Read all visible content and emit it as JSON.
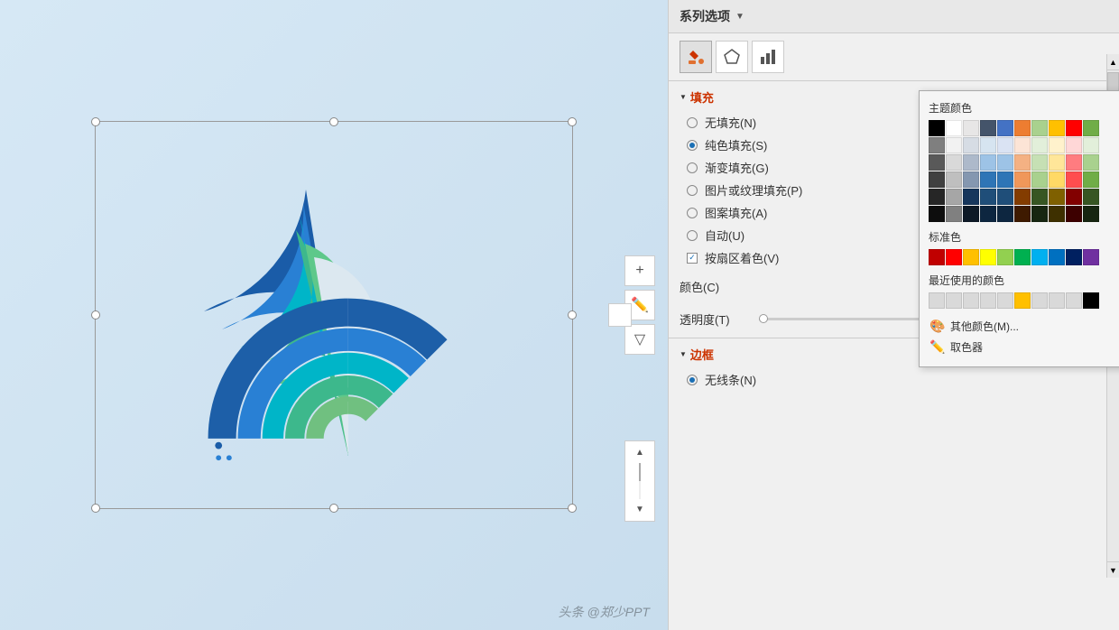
{
  "panel": {
    "title": "系列选项",
    "title_arrow": "▼",
    "tabs": [
      {
        "label": "🎨",
        "title": "fill-tab",
        "active": true
      },
      {
        "label": "⬠",
        "title": "shape-tab"
      },
      {
        "label": "📊",
        "title": "chart-tab"
      }
    ],
    "fill_section": {
      "header": "填充",
      "options": [
        {
          "label": "无填充(N)",
          "type": "radio",
          "selected": false
        },
        {
          "label": "纯色填充(S)",
          "type": "radio",
          "selected": true
        },
        {
          "label": "渐变填充(G)",
          "type": "radio",
          "selected": false
        },
        {
          "label": "图片或纹理填充(P)",
          "type": "radio",
          "selected": false
        },
        {
          "label": "图案填充(A)",
          "type": "radio",
          "selected": false
        },
        {
          "label": "自动(U)",
          "type": "radio",
          "selected": false
        },
        {
          "label": "按扇区着色(V)",
          "type": "checkbox",
          "checked": true
        }
      ]
    },
    "color_row": {
      "label": "颜色(C)",
      "swatch_color": "#e07030"
    },
    "transparency_row": {
      "label": "透明度(T)",
      "value": "0%",
      "slider_pos": 0
    },
    "border_section": {
      "header": "边框",
      "options": [
        {
          "label": "无线条(N)",
          "type": "radio",
          "selected": true
        }
      ]
    }
  },
  "color_popup": {
    "theme_title": "主题颜色",
    "theme_colors": [
      "#000000",
      "#ffffff",
      "#e7e6e6",
      "#44546a",
      "#4472c4",
      "#ed7d31",
      "#a9d18e",
      "#ffc000",
      "#ff0000",
      "#70ad47",
      "#7f7f7f",
      "#f2f2f2",
      "#d6dce4",
      "#d6e4f0",
      "#dae3f3",
      "#fce4d6",
      "#e2efda",
      "#fff2cc",
      "#ffd7d7",
      "#e2efda",
      "#595959",
      "#d9d9d9",
      "#adb9ca",
      "#9dc3e6",
      "#9dc3e6",
      "#f4b183",
      "#c6e0b4",
      "#ffe699",
      "#ff7c80",
      "#a9d18e",
      "#404040",
      "#bfbfbf",
      "#8497b0",
      "#2e75b6",
      "#2e75b6",
      "#f0975a",
      "#a9d18e",
      "#ffd966",
      "#ff4d4f",
      "#70ad47",
      "#262626",
      "#a6a6a6",
      "#16365c",
      "#1f4e79",
      "#1f4e79",
      "#833c00",
      "#375623",
      "#7f6000",
      "#820000",
      "#375623",
      "#0d0d0d",
      "#808080",
      "#0d1926",
      "#0d2640",
      "#0d2640",
      "#3e1a00",
      "#172611",
      "#3e3000",
      "#3d0000",
      "#172611"
    ],
    "standard_title": "标准色",
    "standard_colors": [
      "#c00000",
      "#ff0000",
      "#ffc000",
      "#ffff00",
      "#92d050",
      "#00b050",
      "#00b0f0",
      "#0070c0",
      "#002060",
      "#7030a0"
    ],
    "recent_title": "最近使用的颜色",
    "recent_colors": [
      "#d9d9d9",
      "#d9d9d9",
      "#d9d9d9",
      "#d9d9d9",
      "#d9d9d9",
      "#ffc000",
      "#d9d9d9",
      "#d9d9d9",
      "#d9d9d9",
      "#000000"
    ],
    "action_other": "其他颜色(M)...",
    "action_picker": "取色器"
  },
  "chart": {
    "segments": [
      {
        "color": "#1a5ca8",
        "r_outer": 160,
        "r_inner": 100,
        "start": 180,
        "end": 270
      },
      {
        "color": "#2980d4",
        "r_outer": 140,
        "r_inner": 95,
        "start": 180,
        "end": 250
      },
      {
        "color": "#00b5c8",
        "r_outer": 120,
        "r_inner": 85,
        "start": 180,
        "end": 235
      },
      {
        "color": "#3db88c",
        "r_outer": 100,
        "r_inner": 70,
        "start": 180,
        "end": 225
      },
      {
        "color": "#5ec88a",
        "r_outer": 80,
        "r_inner": 55,
        "start": 180,
        "end": 250
      }
    ]
  },
  "watermark": "头条 @郑少PPT"
}
